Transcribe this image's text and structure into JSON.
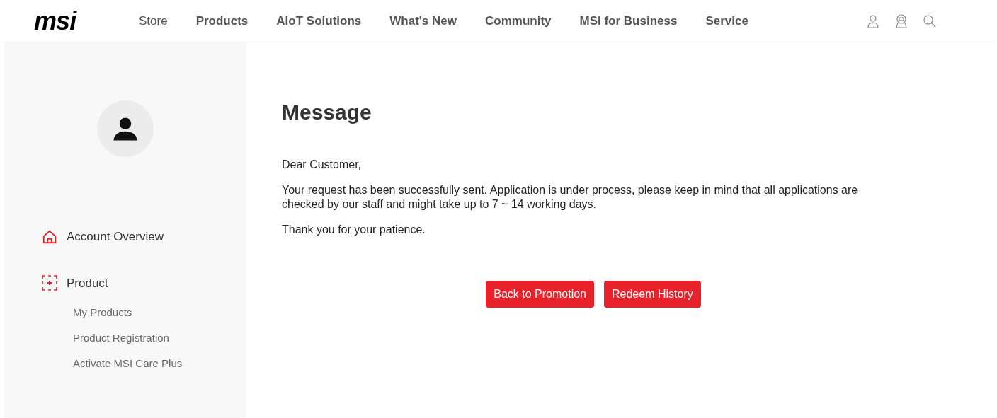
{
  "header": {
    "logo": "msi",
    "nav": [
      "Store",
      "Products",
      "AIoT Solutions",
      "What's New",
      "Community",
      "MSI for Business",
      "Service"
    ]
  },
  "sidebar": {
    "sections": [
      {
        "label": "Account Overview",
        "kind": "home"
      },
      {
        "label": "Product",
        "kind": "product",
        "children": [
          {
            "label": "My Products"
          },
          {
            "label": "Product Registration"
          },
          {
            "label": "Activate MSI Care Plus"
          }
        ]
      }
    ]
  },
  "message": {
    "title": "Message",
    "paragraphs": [
      "Dear Customer,",
      "Your request has been successfully sent. Application is under process, please keep in mind that all applications are checked by our staff and might take up to 7 ~ 14 working days.",
      "Thank you for your patience."
    ],
    "buttons": [
      "Back to Promotion",
      "Redeem History"
    ]
  }
}
